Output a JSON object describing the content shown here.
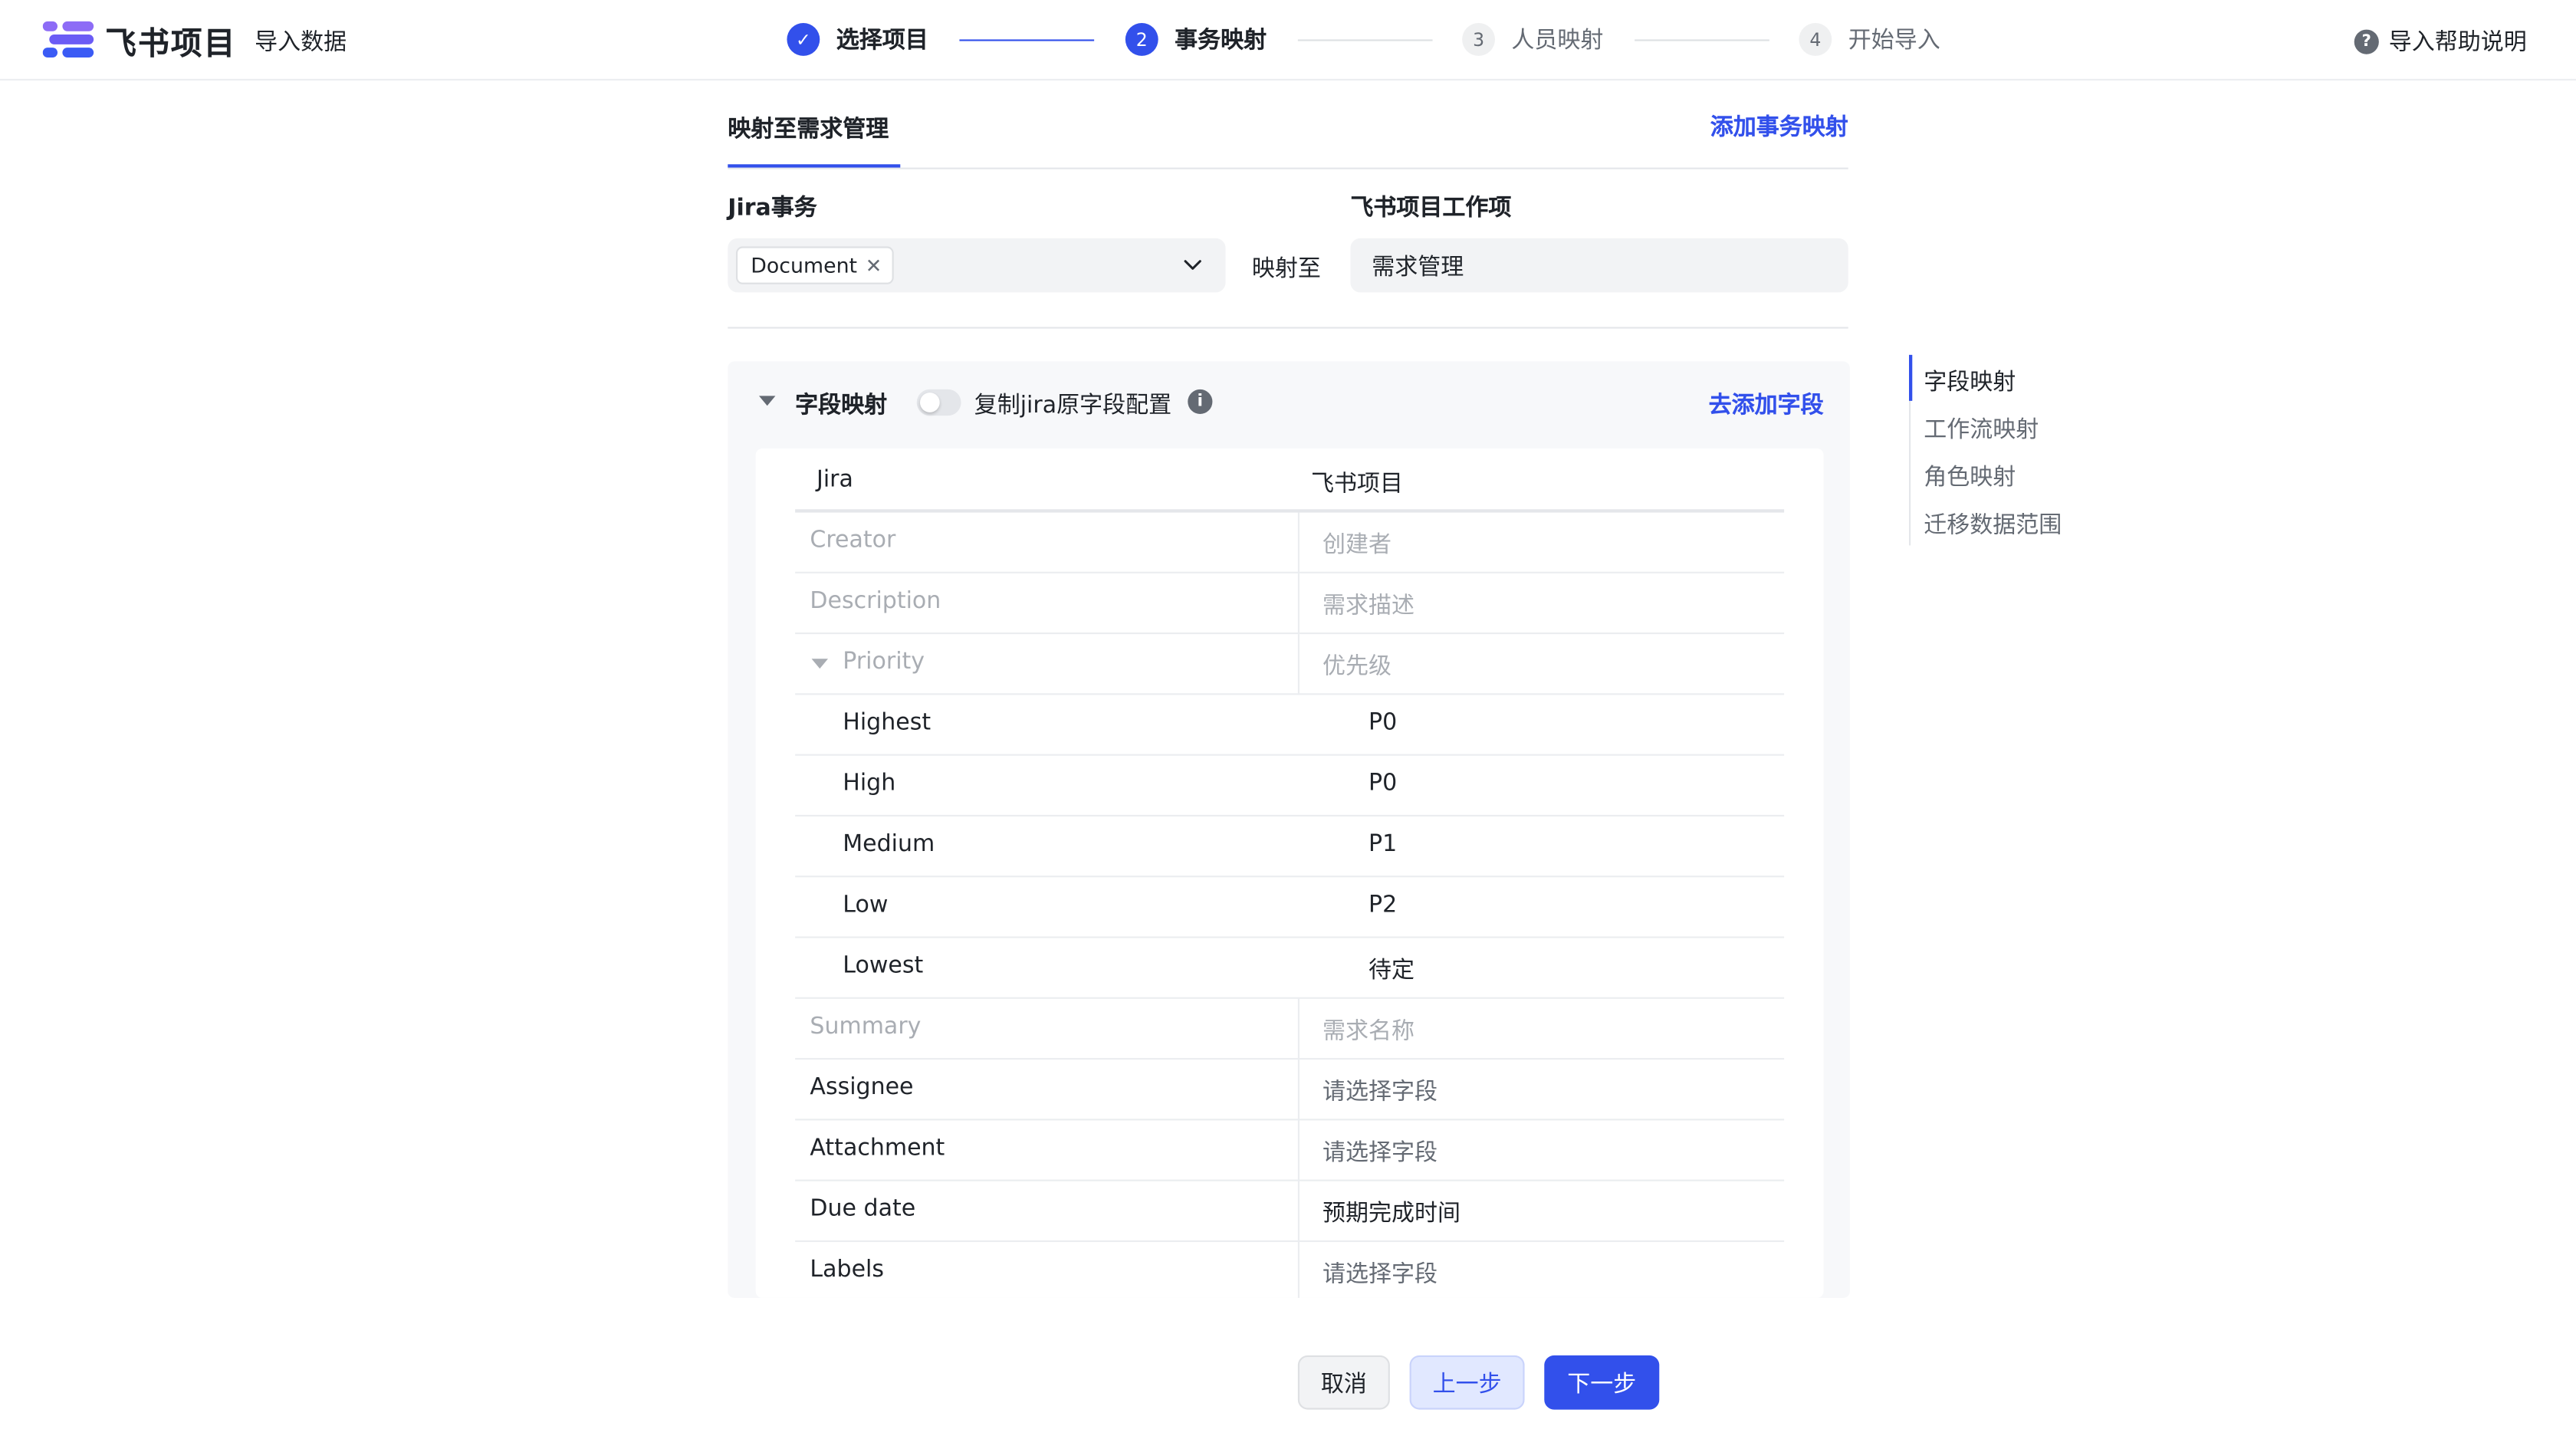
{
  "header": {
    "brand": "飞书项目",
    "page_name": "导入数据",
    "help_label": "导入帮助说明",
    "steps": [
      {
        "num": "✓",
        "label": "选择项目",
        "state": "done"
      },
      {
        "num": "2",
        "label": "事务映射",
        "state": "current"
      },
      {
        "num": "3",
        "label": "人员映射",
        "state": "todo"
      },
      {
        "num": "4",
        "label": "开始导入",
        "state": "todo"
      }
    ]
  },
  "colors": {
    "accent": "#3250eb",
    "logo_purple": "#8d6cf6",
    "logo_blue": "#3b5bf5"
  },
  "tabs": {
    "active_label": "映射至需求管理",
    "add_mapping_label": "添加事务映射"
  },
  "mapping": {
    "jira_label": "Jira事务",
    "feishu_label": "飞书项目工作项",
    "selected_chip": "Document",
    "map_to_label": "映射至",
    "target_value": "需求管理"
  },
  "field_mapping": {
    "title": "字段映射",
    "toggle_label": "复制jira原字段配置",
    "toggle_on": false,
    "add_field_label": "去添加字段",
    "columns": {
      "jira": "Jira",
      "feishu": "飞书项目"
    },
    "rows": [
      {
        "jira": "Creator",
        "feishu": "创建者",
        "style": "muted"
      },
      {
        "jira": "Description",
        "feishu": "需求描述",
        "style": "muted"
      },
      {
        "jira": "Priority",
        "feishu": "优先级",
        "style": "muted",
        "expanded": true
      },
      {
        "jira": "Highest",
        "feishu": "P0",
        "style": "child"
      },
      {
        "jira": "High",
        "feishu": "P0",
        "style": "child"
      },
      {
        "jira": "Medium",
        "feishu": "P1",
        "style": "child"
      },
      {
        "jira": "Low",
        "feishu": "P2",
        "style": "child"
      },
      {
        "jira": "Lowest",
        "feishu": "待定",
        "style": "child"
      },
      {
        "jira": "Summary",
        "feishu": "需求名称",
        "style": "muted"
      },
      {
        "jira": "Assignee",
        "feishu": "请选择字段",
        "style": "placeholder"
      },
      {
        "jira": "Attachment",
        "feishu": "请选择字段",
        "style": "placeholder"
      },
      {
        "jira": "Due date",
        "feishu": "预期完成时间",
        "style": "set"
      },
      {
        "jira": "Labels",
        "feishu": "请选择字段",
        "style": "placeholder"
      }
    ]
  },
  "anchor_nav": [
    {
      "label": "字段映射",
      "active": true
    },
    {
      "label": "工作流映射",
      "active": false
    },
    {
      "label": "角色映射",
      "active": false
    },
    {
      "label": "迁移数据范围",
      "active": false
    }
  ],
  "footer": {
    "cancel_label": "取消",
    "prev_label": "上一步",
    "next_label": "下一步"
  }
}
